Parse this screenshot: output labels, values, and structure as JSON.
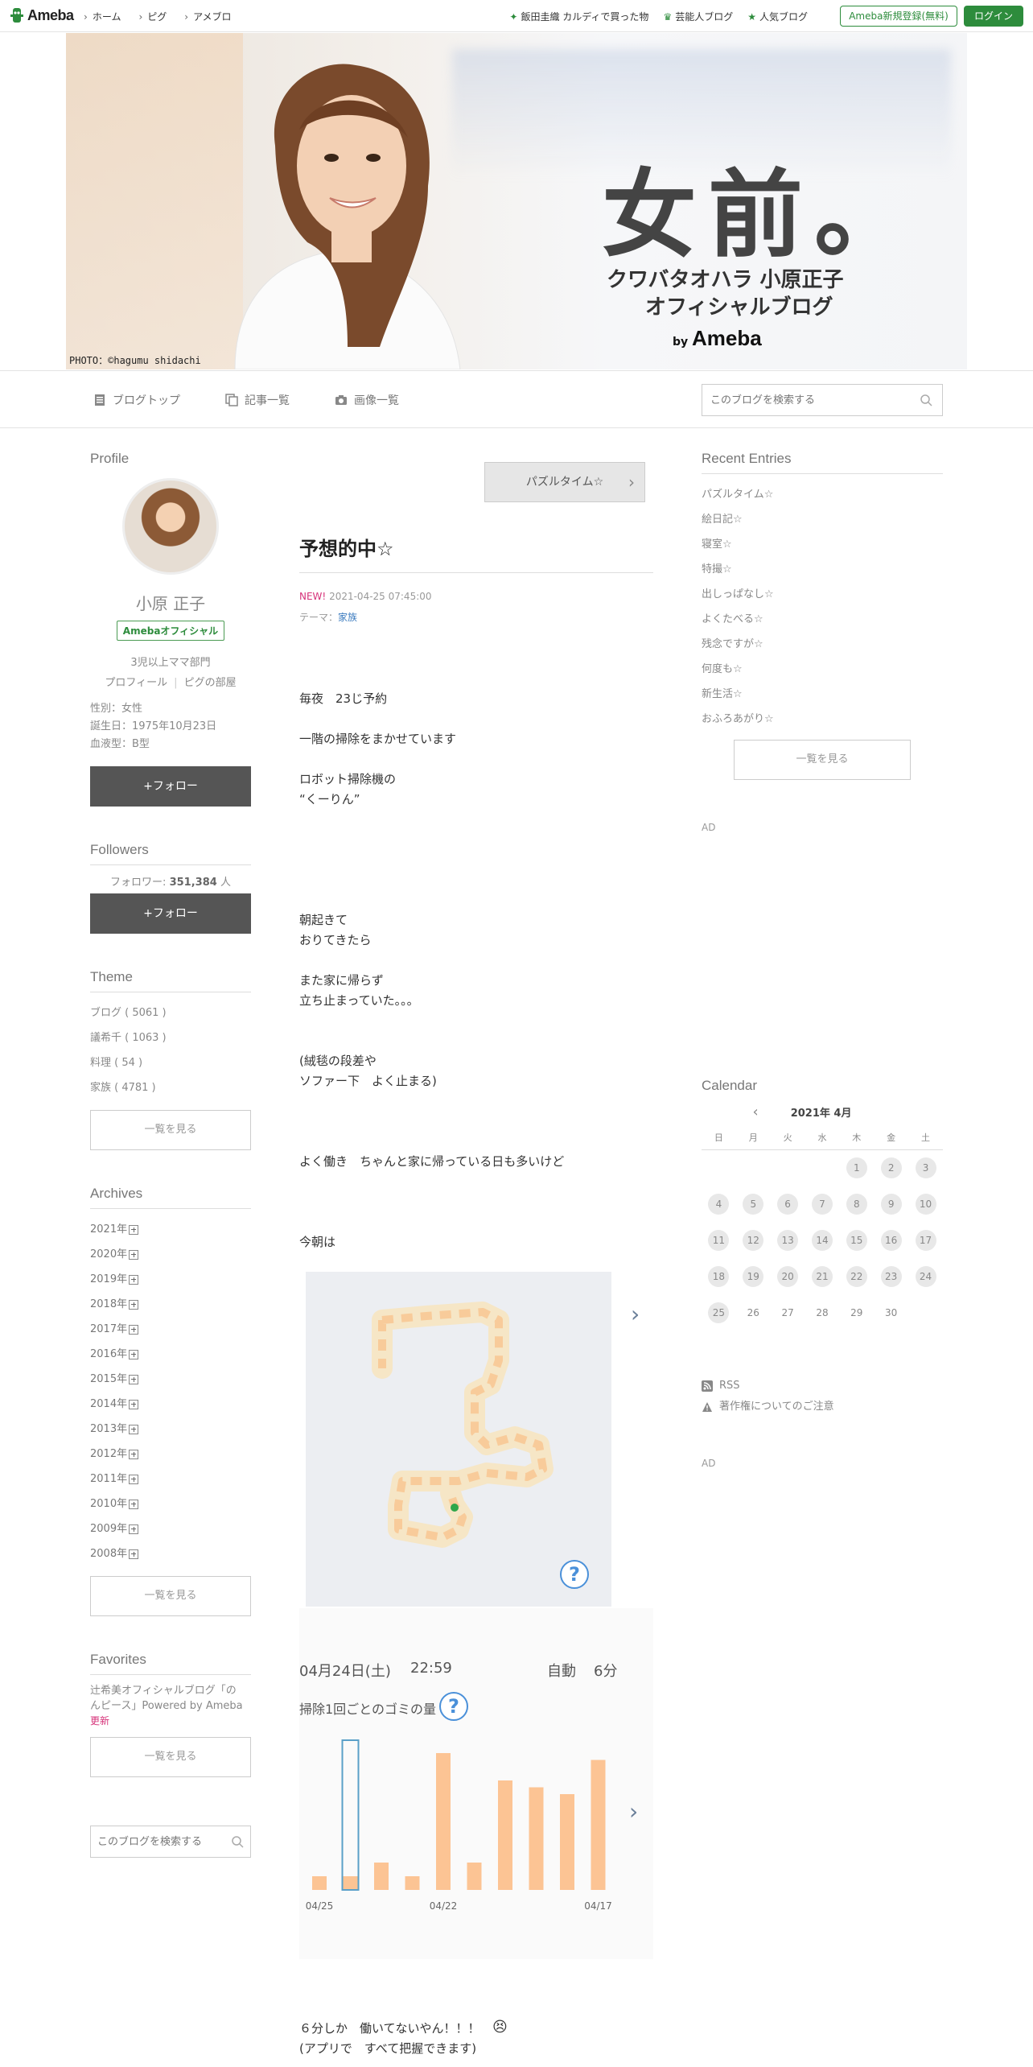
{
  "topbar": {
    "logo": "Ameba",
    "nav": [
      "ホーム",
      "ピグ",
      "アメブロ"
    ],
    "links": [
      {
        "label": "飯田圭織 カルディで買った物",
        "icon": "star-icon"
      },
      {
        "label": "芸能人ブログ",
        "icon": "crown-icon"
      },
      {
        "label": "人気ブログ",
        "icon": "star-icon"
      }
    ],
    "register": "Ameba新規登録(無料)",
    "login": "ログイン"
  },
  "banner": {
    "title": "女前。",
    "subtitle1": "クワバタオハラ 小原正子",
    "subtitle2": "オフィシャルブログ",
    "by": "by",
    "by_brand": "Ameba",
    "photo_credit": "PHOTO：©hagumu shidachi"
  },
  "subnav": {
    "items": [
      "ブログトップ",
      "記事一覧",
      "画像一覧"
    ],
    "search_placeholder": "このブログを検索する"
  },
  "profile": {
    "heading": "Profile",
    "name": "小原 正子",
    "badge": "Amebaオフィシャル",
    "desc": "3児以上ママ部門",
    "link_profile": "プロフィール",
    "link_pig": "ピグの部屋",
    "gender": "性別：女性",
    "birthday": "誕生日：1975年10月23日",
    "blood": "血液型：B型",
    "follow": "+フォロー"
  },
  "followers": {
    "heading": "Followers",
    "label": "フォロワー:",
    "count": "351,384",
    "unit": "人",
    "follow": "+フォロー"
  },
  "theme": {
    "heading": "Theme",
    "items": [
      "ブログ ( 5061 )",
      "議希千 ( 1063 )",
      "料理 ( 54 )",
      "家族 ( 4781 )"
    ],
    "more": "一覧を見る"
  },
  "archives": {
    "heading": "Archives",
    "years": [
      "2021年",
      "2020年",
      "2019年",
      "2018年",
      "2017年",
      "2016年",
      "2015年",
      "2014年",
      "2013年",
      "2012年",
      "2011年",
      "2010年",
      "2009年",
      "2008年"
    ],
    "more": "一覧を見る"
  },
  "favorites": {
    "heading": "Favorites",
    "link1": "辻希美オフィシャルブログ「の",
    "link2": "んピース」Powered by Ameba",
    "new": "更新",
    "more": "一覧を見る",
    "search_placeholder": "このブログを検索する"
  },
  "entry": {
    "next": "パズルタイム☆",
    "title": "予想的中☆",
    "new": "NEW!",
    "date": "2021-04-25 07:45:00",
    "theme_label": "テーマ：",
    "theme": "家族",
    "p1": "毎夜　23じ予約",
    "p2": "一階の掃除をまかせています",
    "p3a": "ロボット掃除機の",
    "p3b": "“くーりん”",
    "p4a": "朝起きて",
    "p4b": "おりてきたら",
    "p5a": "また家に帰らず",
    "p5b": "立ち止まっていた。。。",
    "p6a": "(絨毯の段差や",
    "p6b": "ソファー下　よく止まる)",
    "p7": "よく働き　ちゃんと家に帰っている日も多いけど",
    "p8": "今朝は",
    "p9a": "６分しか　働いてないやん！！！",
    "p9b": "(アプリで　すべて把握できます)"
  },
  "app": {
    "date": "04月24日(土)",
    "time": "22:59",
    "mode": "自動",
    "minutes": "6分",
    "chart_label": "掃除1回ごとのゴミの量",
    "help": "?"
  },
  "chart_data": {
    "type": "bar",
    "categories": [
      "04/25",
      "",
      "",
      "",
      "04/22",
      "",
      "",
      "",
      "",
      "04/17"
    ],
    "x_tick_labels": [
      "04/25",
      "04/22",
      "04/17"
    ],
    "values": [
      1,
      1,
      2,
      1,
      10,
      2,
      8,
      7.5,
      7,
      9.5
    ],
    "selected_index": 1,
    "colors": {
      "bar": "#fcc494",
      "selected_outline": "#5aa0c8"
    }
  },
  "recent": {
    "heading": "Recent Entries",
    "items": [
      "パズルタイム☆",
      "絵日記☆",
      "寝室☆",
      "特撮☆",
      "出しっぱなし☆",
      "よくたべる☆",
      "残念ですが☆",
      "何度も☆",
      "新生活☆",
      "おふろあがり☆"
    ],
    "more": "一覧を見る",
    "ad": "AD"
  },
  "calendar": {
    "heading": "Calendar",
    "prev": "‹",
    "month": "2021年 4月",
    "weekdays": [
      "日",
      "月",
      "火",
      "水",
      "木",
      "金",
      "土"
    ],
    "weeks": [
      [
        "",
        "",
        "",
        "",
        "1",
        "2",
        "3"
      ],
      [
        "4",
        "5",
        "6",
        "7",
        "8",
        "9",
        "10"
      ],
      [
        "11",
        "12",
        "13",
        "14",
        "15",
        "16",
        "17"
      ],
      [
        "18",
        "19",
        "20",
        "21",
        "22",
        "23",
        "24"
      ],
      [
        "25",
        "26",
        "27",
        "28",
        "29",
        "30",
        ""
      ]
    ],
    "marked_through": 25
  },
  "footer_links": {
    "rss": "RSS",
    "copyright": "著作権についてのご注意",
    "ad": "AD"
  }
}
